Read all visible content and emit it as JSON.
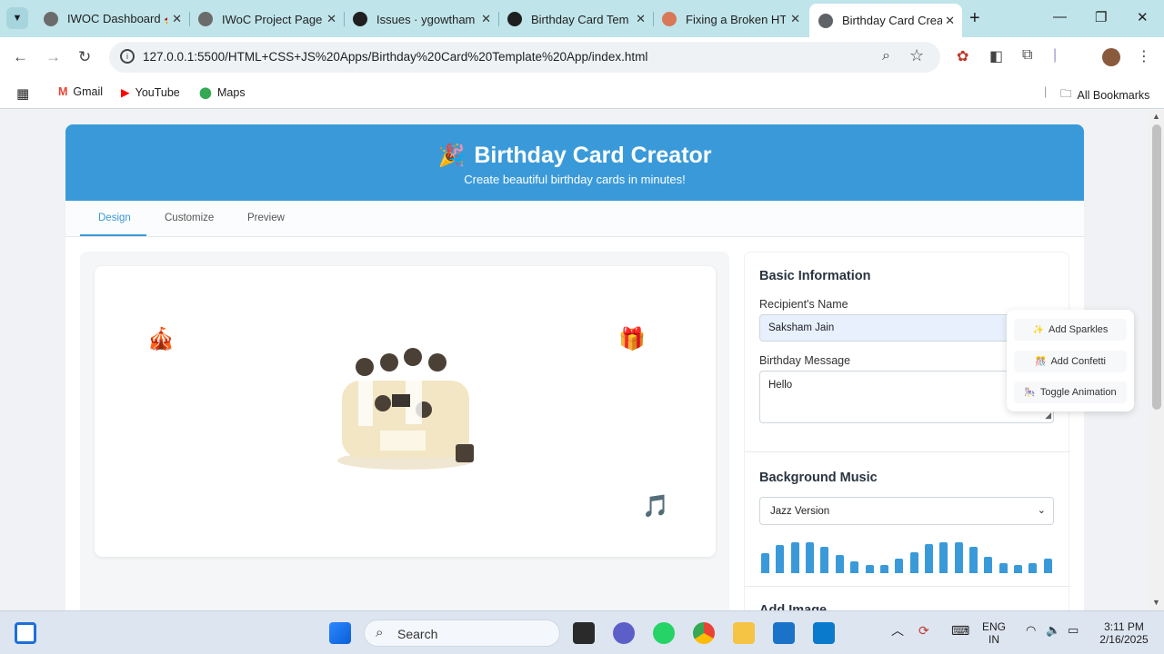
{
  "browser": {
    "tabs": [
      {
        "label": "IWOC Dashboard 🚀",
        "fav_color": "#6b6b6b"
      },
      {
        "label": "IWoC Project Page",
        "fav_color": "#6b6b6b"
      },
      {
        "label": "Issues · ygowtham",
        "fav_color": "#1f1f1f"
      },
      {
        "label": "Birthday Card Tem",
        "fav_color": "#1f1f1f"
      },
      {
        "label": "Fixing a Broken HT",
        "fav_color": "#d97757"
      },
      {
        "label": "Birthday Card Crea",
        "fav_color": "#5f6368"
      }
    ],
    "url": "127.0.0.1:5500/HTML+CSS+JS%20Apps/Birthday%20Card%20Template%20App/index.html",
    "bookmarks": [
      {
        "label": "Gmail"
      },
      {
        "label": "YouTube"
      },
      {
        "label": "Maps"
      }
    ],
    "all_bookmarks": "All Bookmarks"
  },
  "app": {
    "title": "Birthday Card Creator",
    "title_emoji": "🎉",
    "subtitle": "Create beautiful birthday cards in minutes!",
    "tabs": [
      "Design",
      "Customize",
      "Preview"
    ],
    "card": {
      "emoji_tent": "🎪",
      "emoji_gift": "🎁",
      "emoji_music": "🎵"
    },
    "basic_info": {
      "title": "Basic Information",
      "name_label": "Recipient's Name",
      "name_value": "Saksham Jain",
      "message_label": "Birthday Message",
      "message_value": "Hello"
    },
    "music": {
      "title": "Background Music",
      "selected": "Jazz Version",
      "visualizer_levels": [
        0.6,
        0.85,
        0.95,
        0.95,
        0.8,
        0.55,
        0.35,
        0.25,
        0.25,
        0.45,
        0.65,
        0.9,
        0.95,
        0.95,
        0.8,
        0.5,
        0.3,
        0.25,
        0.3,
        0.45
      ]
    },
    "add_image": {
      "title": "Add Image"
    },
    "popup": {
      "sparkles": "Add Sparkles",
      "confetti": "Add Confetti",
      "animation": "Toggle Animation"
    },
    "accent_color": "#3a9ad9"
  },
  "taskbar": {
    "search": "Search",
    "lang": "ENG",
    "region": "IN",
    "time": "3:11 PM",
    "date": "2/16/2025"
  }
}
